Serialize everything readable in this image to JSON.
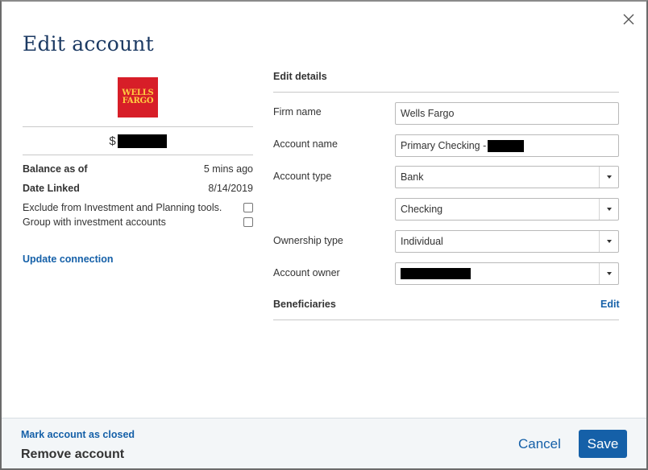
{
  "dialog": {
    "title": "Edit account",
    "close_icon": "close-icon"
  },
  "account_summary": {
    "logo_line1": "WELLS",
    "logo_line2": "FARGO",
    "logo_color": "#d71e28",
    "logo_text_color": "#ffcd41",
    "balance_symbol": "$",
    "balance_as_of_label": "Balance as of",
    "balance_as_of_value": "5 mins ago",
    "date_linked_label": "Date Linked",
    "date_linked_value": "8/14/2019",
    "exclude_label": "Exclude from Investment and Planning tools.",
    "exclude_checked": false,
    "group_label": "Group with investment accounts",
    "group_checked": false,
    "update_connection": "Update connection"
  },
  "edit_details": {
    "heading": "Edit details",
    "firm_name_label": "Firm name",
    "firm_name_value": "Wells Fargo",
    "account_name_label": "Account name",
    "account_name_value": "Primary Checking -",
    "account_type_label": "Account type",
    "account_type_value": "Bank",
    "account_subtype_value": "Checking",
    "ownership_type_label": "Ownership type",
    "ownership_type_value": "Individual",
    "account_owner_label": "Account owner",
    "beneficiaries_label": "Beneficiaries",
    "beneficiaries_edit": "Edit"
  },
  "footer": {
    "mark_closed": "Mark account as closed",
    "remove_account": "Remove account",
    "cancel": "Cancel",
    "save": "Save"
  },
  "colors": {
    "accent": "#1560a8",
    "title": "#1c3a63",
    "footer_bg": "#f3f6f8"
  }
}
